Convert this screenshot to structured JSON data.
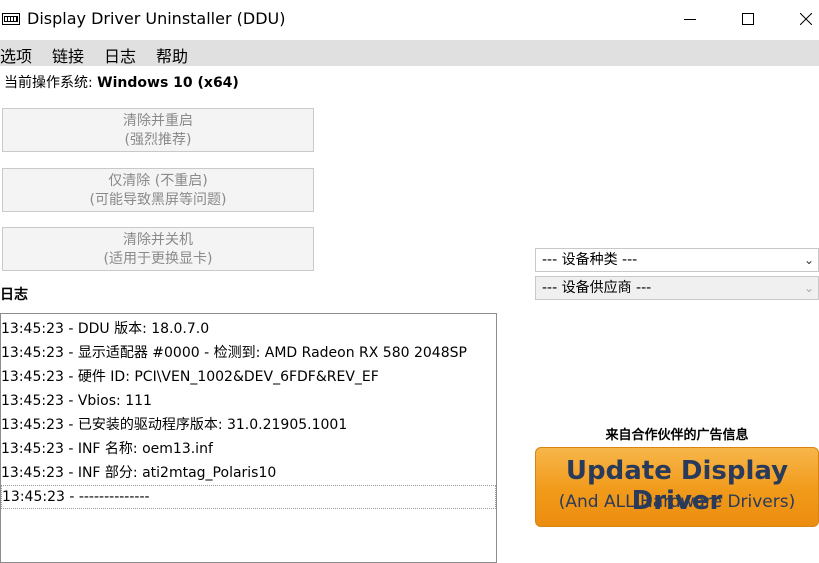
{
  "window": {
    "title": "Display Driver Uninstaller (DDU)",
    "minimize_glyph": "—",
    "maximize_glyph": "☐",
    "close_glyph": "✕"
  },
  "menu": {
    "items": [
      "选项",
      "链接",
      "日志",
      "帮助"
    ]
  },
  "os": {
    "label": "当前操作系统:",
    "value": "Windows 10 (x64)"
  },
  "actions": [
    {
      "line1": "清除并重启",
      "line2": "(强烈推荐)"
    },
    {
      "line1": "仅清除 (不重启)",
      "line2": "(可能导致黑屏等问题)"
    },
    {
      "line1": "清除并关机",
      "line2": "(适用于更换显卡)"
    }
  ],
  "log": {
    "label": "日志",
    "entries": [
      "13:45:23 - DDU 版本: 18.0.7.0",
      "13:45:23 - 显示适配器 #0000 - 检测到: AMD Radeon RX 580 2048SP",
      "13:45:23 - 硬件 ID: PCI\\VEN_1002&DEV_6FDF&REV_EF",
      "13:45:23 - Vbios: 111",
      "13:45:23 - 已安装的驱动程序版本: 31.0.21905.1001",
      "13:45:23 - INF 名称: oem13.inf",
      "13:45:23 - INF 部分: ati2mtag_Polaris10",
      "13:45:23 - --------------"
    ]
  },
  "device_type": {
    "value": "--- 设备种类 ---"
  },
  "device_vendor": {
    "value": "--- 设备供应商 ---"
  },
  "ad": {
    "label": "来自合作伙伴的广告信息",
    "main": "Update Display Driver",
    "sub": "(And ALL Hardware Drivers)"
  },
  "colors": {
    "menubar": "#e0e0e0",
    "disabled_text": "#8a8a8a",
    "ad_orange": "#f19a1a",
    "ad_text": "#2a3a5a"
  },
  "icons": [
    "ddu-app-icon",
    "minimize-icon",
    "maximize-icon",
    "close-icon",
    "chevron-down-icon"
  ]
}
